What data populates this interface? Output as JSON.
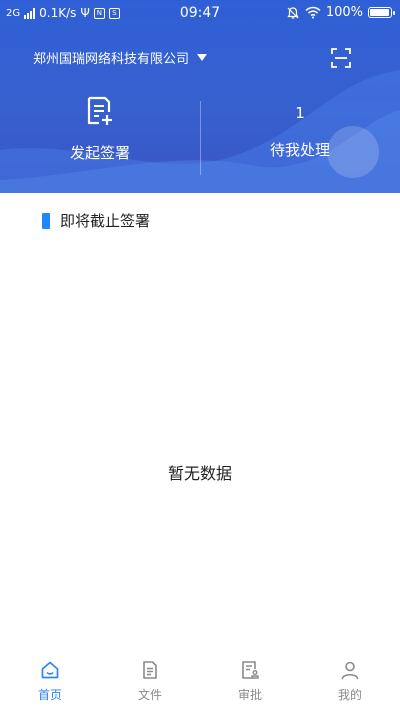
{
  "status_bar": {
    "network": "2G",
    "speed": "0.1K/s",
    "usb_symbol": "Ψ",
    "badge_a": "N",
    "badge_b": "S",
    "time": "09:47",
    "battery": "100%"
  },
  "header": {
    "company_name": "郑州国瑞网络科技有限公司",
    "start_sign_label": "发起签署",
    "pending_count": "1",
    "pending_label": "待我处理"
  },
  "section": {
    "title": "即将截止签署",
    "empty_text": "暂无数据"
  },
  "tabbar": {
    "items": [
      {
        "label": "首页",
        "icon": "home-icon",
        "active": true
      },
      {
        "label": "文件",
        "icon": "file-icon",
        "active": false
      },
      {
        "label": "审批",
        "icon": "approval-icon",
        "active": false
      },
      {
        "label": "我的",
        "icon": "user-icon",
        "active": false
      }
    ]
  },
  "colors": {
    "header_blue": "#2f5fd6",
    "accent": "#1e88ff",
    "tab_active": "#2d86f0",
    "tab_inactive": "#8a8a8a"
  }
}
